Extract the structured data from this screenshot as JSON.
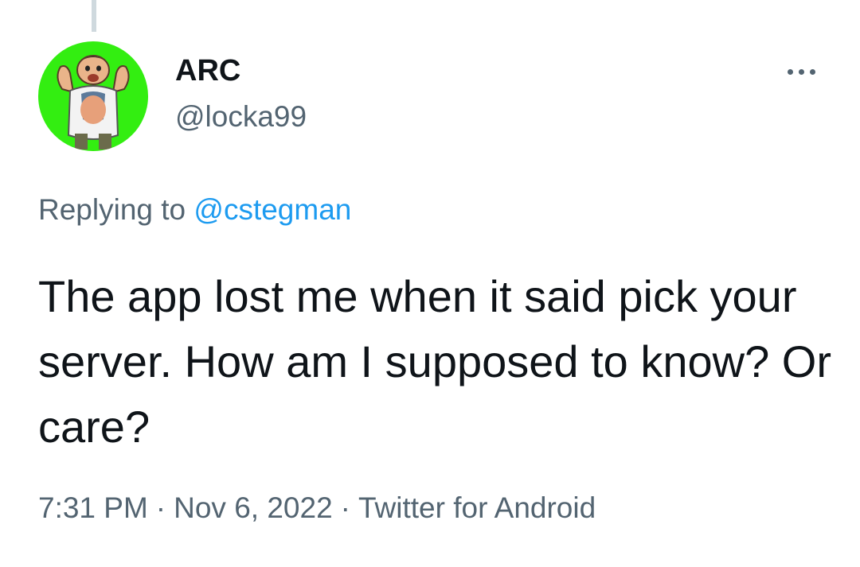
{
  "tweet": {
    "author": {
      "display_name": "ARC",
      "handle": "@locka99",
      "avatar": "avatar-image",
      "avatar_bg": "#33ee11"
    },
    "more_icon": "more-horizontal-icon",
    "replying_to": {
      "prefix": "Replying to",
      "mention": "@cstegman"
    },
    "text": "The app lost me when it said pick your server. How am I supposed to know? Or care?",
    "meta": {
      "time": "7:31 PM",
      "separator": "·",
      "date": "Nov 6, 2022",
      "source": "Twitter for Android"
    }
  },
  "colors": {
    "text": "#0f1419",
    "secondary": "#536471",
    "accent": "#1d9bf0",
    "thread_line": "#cfd9de"
  }
}
